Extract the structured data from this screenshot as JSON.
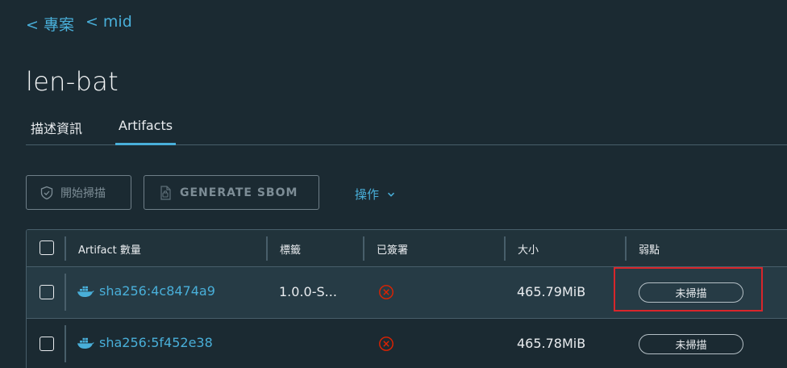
{
  "breadcrumb": [
    {
      "label": "< 專案"
    },
    {
      "label": "< mid"
    }
  ],
  "page_title": "len-bat",
  "tabs": [
    {
      "label": "描述資訊",
      "active": false
    },
    {
      "label": "Artifacts",
      "active": true
    }
  ],
  "toolbar": {
    "scan_label": "開始掃描",
    "sbom_label": "GENERATE SBOM",
    "actions_label": "操作"
  },
  "table": {
    "headers": [
      "Artifact 數量",
      "標籤",
      "已簽署",
      "大小",
      "弱點"
    ],
    "rows": [
      {
        "digest": "sha256:4c8474a9",
        "tag": "1.0.0-S...",
        "signed": "x-circle-icon",
        "size": "465.79MiB",
        "vulnerability": "未掃描"
      },
      {
        "digest": "sha256:5f452e38",
        "tag": "",
        "signed": "x-circle-icon",
        "size": "465.78MiB",
        "vulnerability": "未掃描"
      }
    ]
  },
  "colors": {
    "background": "#1b2a32",
    "accent": "#49afd9",
    "error": "#e12200",
    "highlight": "#d8262b"
  }
}
